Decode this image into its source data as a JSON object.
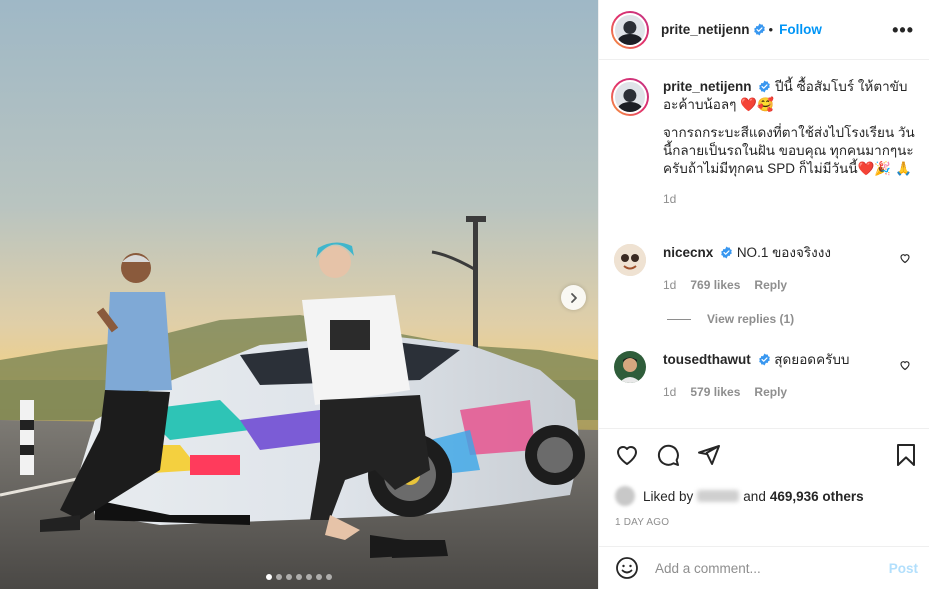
{
  "post": {
    "username": "prite_netijenn",
    "follow_label": "Follow",
    "more_icon": "more-horizontal-icon",
    "caption": {
      "line1": "ปีนี้ ซื้อสัมโบร์ ให้ตาขับอะค้าบน้อลๆ",
      "line1_emoji": "❤️🥰",
      "para2": "จากรถกระบะสีแดงที่ตาใช้ส่งไปโรงเรียน วันนี้กลายเป็นรถในฝัน ขอบคุณ ทุกคนมากๆนะครับถ้าไม่มีทุกคน SPD ก็ไม่มีวันนี้",
      "para2_emoji": "❤️🎉 🙏",
      "time": "1d"
    }
  },
  "comments": [
    {
      "username": "nicecnx",
      "text": "NO.1 ของจริงงง",
      "time": "1d",
      "likes": "769 likes",
      "reply": "Reply"
    },
    {
      "username": "tousedthawut",
      "text": "สุดยอดครับบ",
      "time": "1d",
      "likes": "579 likes",
      "reply": "Reply"
    }
  ],
  "view_replies": "View replies (1)",
  "actions": {
    "liked_by_prefix": "Liked by",
    "liked_by_suffix": "and",
    "others": "469,936 others",
    "date": "1 DAY AGO"
  },
  "add_comment": {
    "placeholder": "Add a comment...",
    "post_label": "Post"
  },
  "carousel": {
    "total": 7,
    "active": 1
  },
  "colors": {
    "accent": "#0095f6",
    "verified": "#3897f0",
    "like_red": "#ed4956"
  }
}
